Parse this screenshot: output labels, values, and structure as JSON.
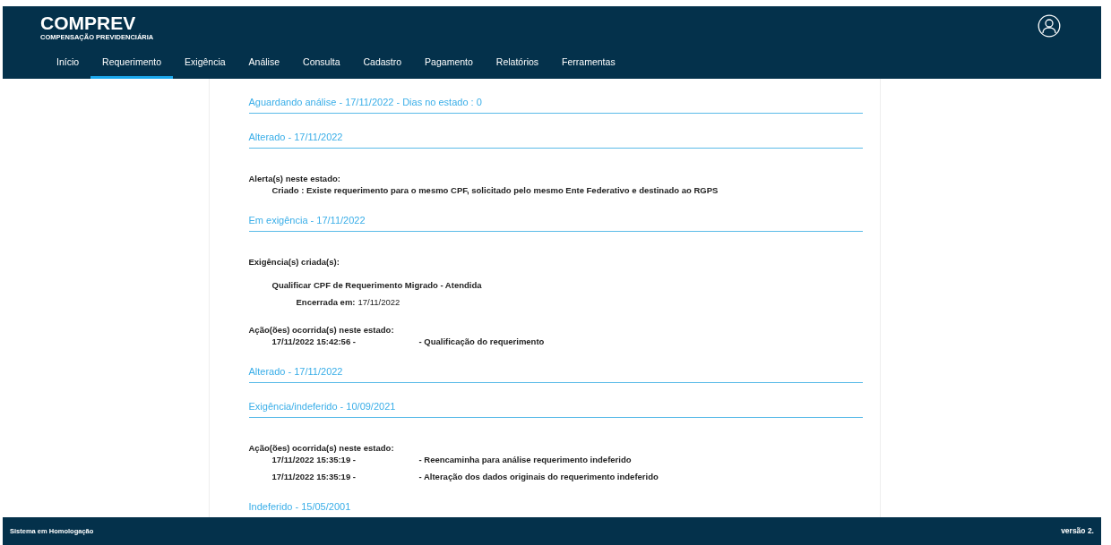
{
  "header": {
    "brand": "COMPREV",
    "subtitle": "COMPENSAÇÃO PREVIDENCIÁRIA"
  },
  "nav": [
    {
      "label": "Início",
      "selected": false
    },
    {
      "label": "Requerimento",
      "selected": true
    },
    {
      "label": "Exigência",
      "selected": false
    },
    {
      "label": "Análise",
      "selected": false
    },
    {
      "label": "Consulta",
      "selected": false
    },
    {
      "label": "Cadastro",
      "selected": false
    },
    {
      "label": "Pagamento",
      "selected": false
    },
    {
      "label": "Relatórios",
      "selected": false
    },
    {
      "label": "Ferramentas",
      "selected": false
    }
  ],
  "states": [
    {
      "heading": "Aguardando análise - 17/11/2022 - Dias no estado : 0"
    },
    {
      "heading": "Alterado - 17/11/2022",
      "blocks": [
        {
          "kind": "alerts",
          "label": "Alerta(s) neste estado:",
          "items": [
            "Criado : Existe requerimento para o mesmo CPF, solicitado pelo mesmo Ente Federativo e destinado ao RGPS"
          ]
        }
      ]
    },
    {
      "heading": "Em exigência - 17/11/2022",
      "blocks": [
        {
          "kind": "requirements",
          "label": "Exigência(s) criada(s):",
          "items": [
            {
              "title": "Qualificar CPF de Requerimento Migrado - Atendida",
              "closed_label": "Encerrada em:",
              "closed_date": "17/11/2022"
            }
          ]
        },
        {
          "kind": "actions",
          "label": "Ação(ões) ocorrida(s) neste estado:",
          "rows": [
            {
              "time": "17/11/2022 15:42:56 -",
              "description": "- Qualificação do requerimento"
            }
          ]
        }
      ]
    },
    {
      "heading": "Alterado - 17/11/2022"
    },
    {
      "heading": "Exigência/indeferido - 10/09/2021",
      "blocks": [
        {
          "kind": "actions",
          "label": "Ação(ões) ocorrida(s) neste estado:",
          "rows": [
            {
              "time": "17/11/2022 15:35:19 -",
              "description": "- Reencaminha para análise requerimento indeferido"
            },
            {
              "time": "17/11/2022 15:35:19 -",
              "description": "- Alteração dos dados originais do requerimento indeferido"
            }
          ]
        }
      ]
    },
    {
      "heading": "Indeferido - 15/05/2001"
    }
  ],
  "footer": {
    "left": "Sistema em Homologação",
    "right": "versão 2."
  }
}
